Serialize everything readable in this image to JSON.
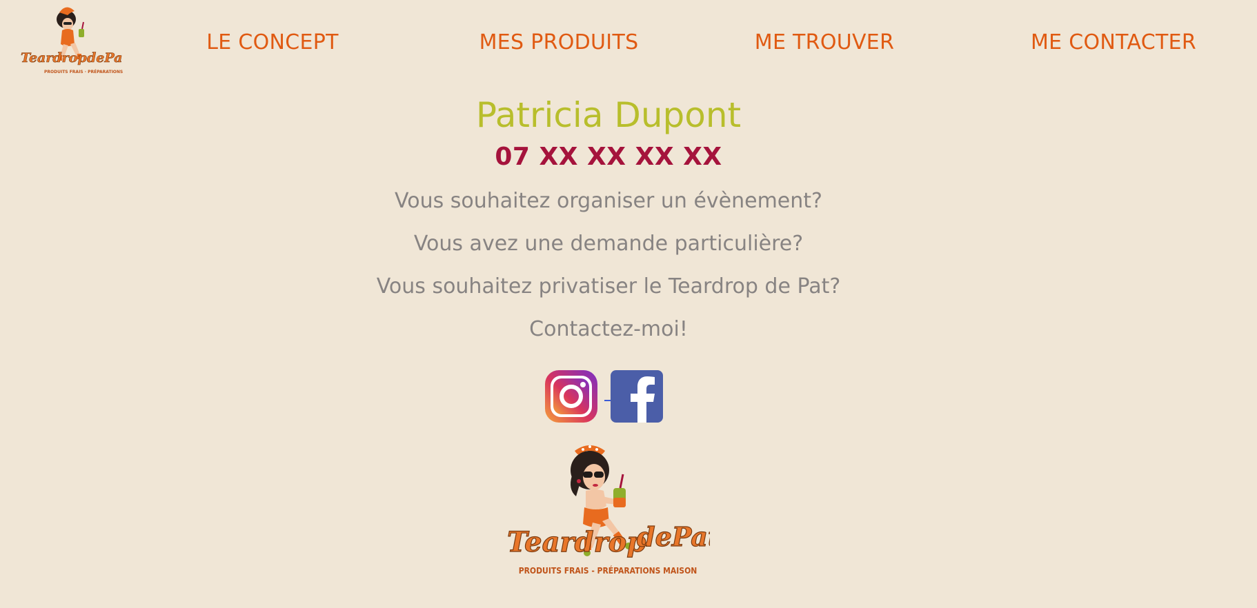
{
  "header": {
    "logo_alt": "Teardrop de Pat",
    "nav": [
      {
        "label": "LE CONCEPT"
      },
      {
        "label": "MES PRODUITS"
      },
      {
        "label": "ME TROUVER"
      },
      {
        "label": "ME CONTACTER"
      }
    ]
  },
  "contact": {
    "name": "Patricia Dupont",
    "phone": "07 XX XX XX XX",
    "lines": [
      "Vous souhaitez organiser un évènement?",
      "Vous avez une demande particulière?",
      "Vous souhaitez privatiser le Teardrop de Pat?",
      "Contactez-moi!"
    ]
  },
  "social": {
    "instagram_icon": "instagram-icon",
    "facebook_icon": "facebook-icon"
  },
  "footer": {
    "logo_title": "Teardrop de Pat",
    "logo_tagline": "PRODUITS FRAIS - PRÉPARATIONS MAISON"
  },
  "colors": {
    "background": "#f0e6d6",
    "nav": "#e05a12",
    "name": "#b8be2c",
    "phone": "#a5133c",
    "text": "#878382",
    "facebook": "#4b5ea8"
  }
}
